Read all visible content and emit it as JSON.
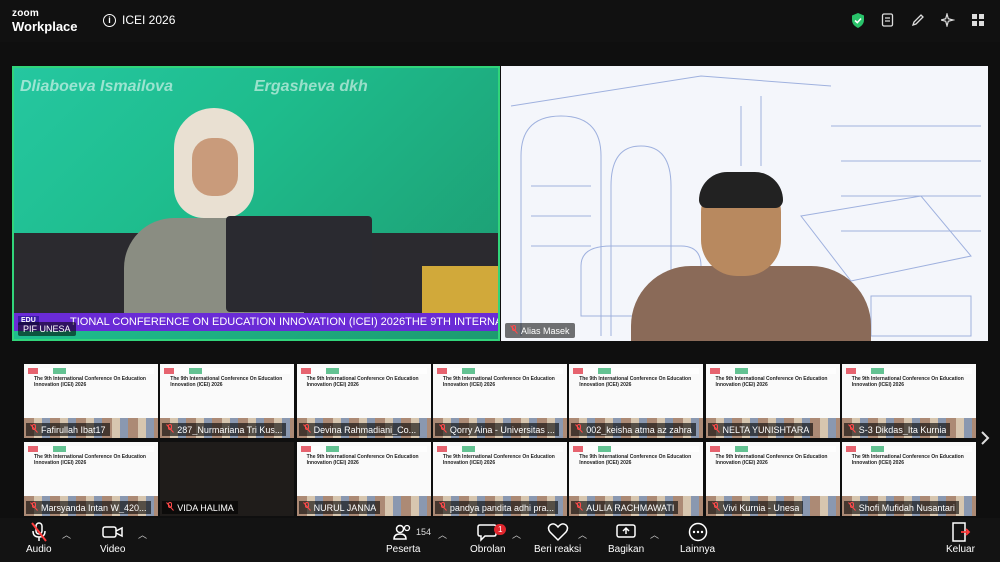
{
  "app": {
    "brand_top": "zoom",
    "brand_bottom": "Workplace",
    "meeting_title": "ICEI 2026"
  },
  "top_icons": [
    "shield-check-icon",
    "notes-icon",
    "pen-icon",
    "sparkle-icon",
    "grid-icon"
  ],
  "main_tiles": [
    {
      "name": "PIF UNESA",
      "ticker": "TIONAL CONFERENCE ON EDUCATION INNOVATION (ICEI) 2026THE 9TH INTERNA",
      "edu_label": "EDU",
      "banner_1": "Dliaboeva Ismailova",
      "banner_2": "Ergasheva dkh"
    },
    {
      "name": "Alias Masek"
    }
  ],
  "gallery_title_line1": "The 9th International Conference On Education",
  "gallery_title_line2": "Innovation (ICEI) 2026",
  "gallery": [
    {
      "name": "Fafirullah Ibat17",
      "dark": false
    },
    {
      "name": "287_Nurmariana Tri Kus...",
      "dark": false
    },
    {
      "name": "Devina Rahmadiani_Co...",
      "dark": false
    },
    {
      "name": "Qorry Aina - Universitas ...",
      "dark": false
    },
    {
      "name": "002_keisha atma az zahra",
      "dark": false
    },
    {
      "name": "NELTA YUNISHTARA",
      "dark": false
    },
    {
      "name": "S-3 Dikdas_Ita Kurnia",
      "dark": false
    },
    {
      "name": "Marsyanda Intan W_420...",
      "dark": false
    },
    {
      "name": "VIDA HALIMA",
      "dark": true
    },
    {
      "name": "NURUL JANNA",
      "dark": false
    },
    {
      "name": "pandya pandita adhi pra...",
      "dark": false
    },
    {
      "name": "AULIA RACHMAWATI",
      "dark": false
    },
    {
      "name": "Vivi Kurnia - Unesa",
      "dark": false
    },
    {
      "name": "Shofi Mufidah Nusantari",
      "dark": false
    }
  ],
  "toolbar": {
    "audio": "Audio",
    "video": "Video",
    "participants": "Peserta",
    "participants_count": "154",
    "chat": "Obrolan",
    "chat_badge": "1",
    "reactions": "Beri reaksi",
    "share": "Bagikan",
    "more": "Lainnya",
    "leave": "Keluar"
  }
}
